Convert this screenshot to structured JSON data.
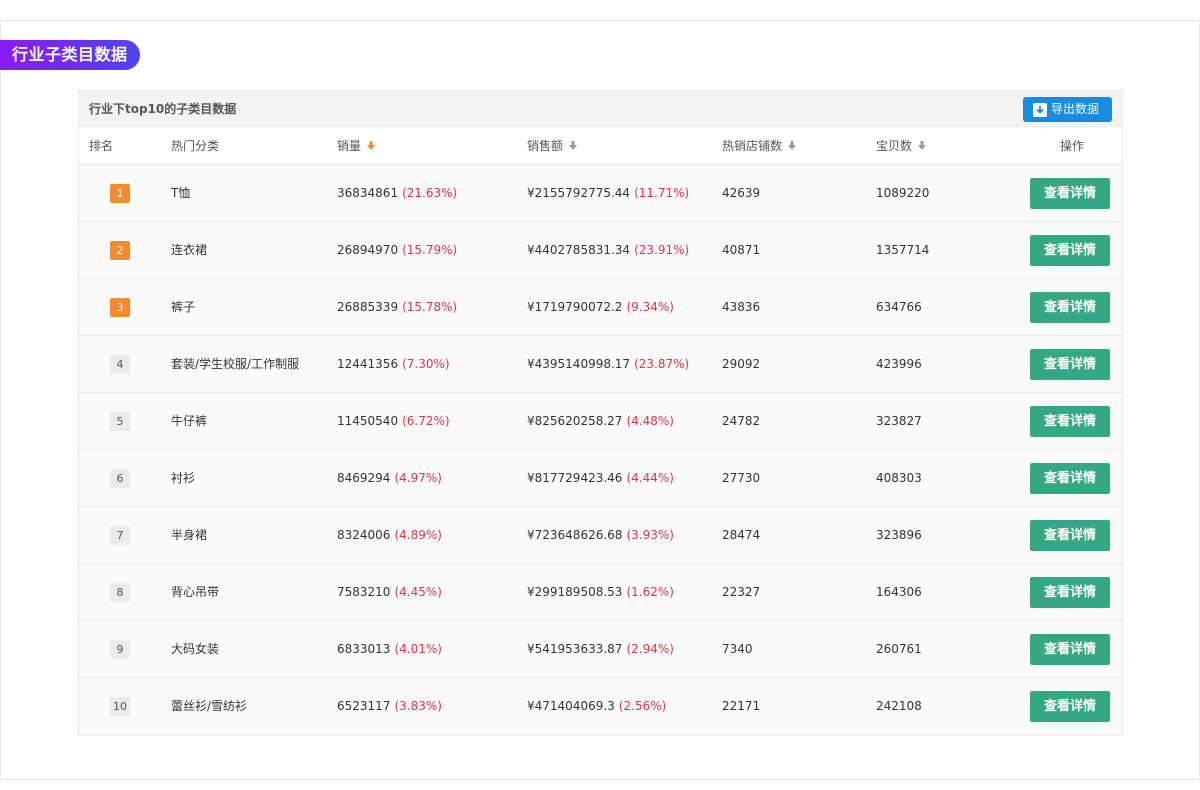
{
  "section": {
    "title": "行业子类目数据"
  },
  "panel": {
    "title": "行业下top10的子类目数据",
    "export_label": "导出数据"
  },
  "columns": {
    "rank": "排名",
    "category": "热门分类",
    "sales": "销量",
    "revenue": "销售额",
    "shops": "热销店铺数",
    "items": "宝贝数",
    "action": "操作"
  },
  "colors": {
    "sort_active": "#f68a2f",
    "sort_inactive": "#999999",
    "detail_button": "#34a883",
    "export_button": "#1b8be0",
    "percent_text": "#e0354a"
  },
  "rows": [
    {
      "rank": "1",
      "category": "T恤",
      "sales": "36834861",
      "sales_pct": "(21.63%)",
      "revenue": "¥2155792775.44",
      "revenue_pct": "(11.71%)",
      "shops": "42639",
      "items": "1089220",
      "action": "查看详情"
    },
    {
      "rank": "2",
      "category": "连衣裙",
      "sales": "26894970",
      "sales_pct": "(15.79%)",
      "revenue": "¥4402785831.34",
      "revenue_pct": "(23.91%)",
      "shops": "40871",
      "items": "1357714",
      "action": "查看详情"
    },
    {
      "rank": "3",
      "category": "裤子",
      "sales": "26885339",
      "sales_pct": "(15.78%)",
      "revenue": "¥1719790072.2",
      "revenue_pct": "(9.34%)",
      "shops": "43836",
      "items": "634766",
      "action": "查看详情"
    },
    {
      "rank": "4",
      "category": "套装/学生校服/工作制服",
      "sales": "12441356",
      "sales_pct": "(7.30%)",
      "revenue": "¥4395140998.17",
      "revenue_pct": "(23.87%)",
      "shops": "29092",
      "items": "423996",
      "action": "查看详情"
    },
    {
      "rank": "5",
      "category": "牛仔裤",
      "sales": "11450540",
      "sales_pct": "(6.72%)",
      "revenue": "¥825620258.27",
      "revenue_pct": "(4.48%)",
      "shops": "24782",
      "items": "323827",
      "action": "查看详情"
    },
    {
      "rank": "6",
      "category": "衬衫",
      "sales": "8469294",
      "sales_pct": "(4.97%)",
      "revenue": "¥817729423.46",
      "revenue_pct": "(4.44%)",
      "shops": "27730",
      "items": "408303",
      "action": "查看详情"
    },
    {
      "rank": "7",
      "category": "半身裙",
      "sales": "8324006",
      "sales_pct": "(4.89%)",
      "revenue": "¥723648626.68",
      "revenue_pct": "(3.93%)",
      "shops": "28474",
      "items": "323896",
      "action": "查看详情"
    },
    {
      "rank": "8",
      "category": "背心吊带",
      "sales": "7583210",
      "sales_pct": "(4.45%)",
      "revenue": "¥299189508.53",
      "revenue_pct": "(1.62%)",
      "shops": "22327",
      "items": "164306",
      "action": "查看详情"
    },
    {
      "rank": "9",
      "category": "大码女装",
      "sales": "6833013",
      "sales_pct": "(4.01%)",
      "revenue": "¥541953633.87",
      "revenue_pct": "(2.94%)",
      "shops": "7340",
      "items": "260761",
      "action": "查看详情"
    },
    {
      "rank": "10",
      "category": "蕾丝衫/雪纺衫",
      "sales": "6523117",
      "sales_pct": "(3.83%)",
      "revenue": "¥471404069.3",
      "revenue_pct": "(2.56%)",
      "shops": "22171",
      "items": "242108",
      "action": "查看详情"
    }
  ]
}
